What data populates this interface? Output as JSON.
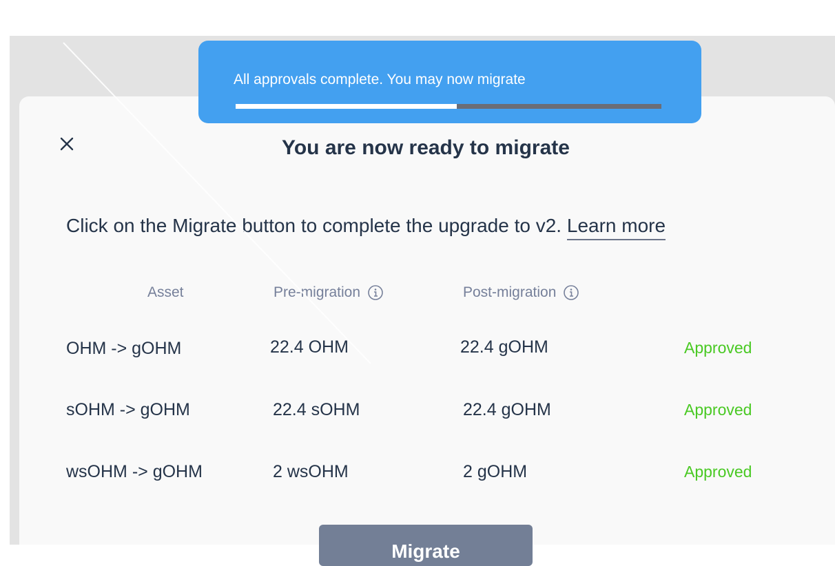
{
  "toast": {
    "message": "All approvals complete. You may now migrate",
    "progress": 0.52
  },
  "modal": {
    "title": "You are now ready to migrate",
    "description": "Click on the Migrate button to complete the upgrade to v2.",
    "learn_more": "Learn more",
    "close_icon": "close-icon"
  },
  "table": {
    "headers": {
      "asset": "Asset",
      "pre": "Pre-migration",
      "post": "Post-migration"
    },
    "info_icon": "info-icon",
    "rows": [
      {
        "asset": "OHM -> gOHM",
        "pre": "22.4 OHM",
        "post": "22.4 gOHM",
        "status": "Approved"
      },
      {
        "asset": "sOHM -> gOHM",
        "pre": "22.4 sOHM",
        "post": "22.4 gOHM",
        "status": "Approved"
      },
      {
        "asset": "wsOHM -> gOHM",
        "pre": "2 wsOHM",
        "post": "2 gOHM",
        "status": "Approved"
      }
    ]
  },
  "migrate_button": "Migrate",
  "colors": {
    "toast_bg": "#43a0f0",
    "approved": "#49c923",
    "button_bg": "#737f96",
    "text": "#253449"
  }
}
